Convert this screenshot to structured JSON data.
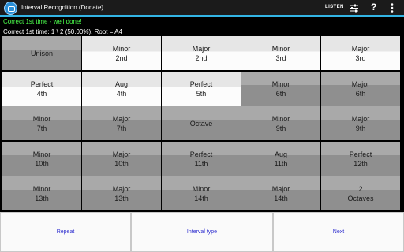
{
  "app": {
    "title": "Interval Recognition (Donate)",
    "listen_label": "LISTEN",
    "help_label": "?"
  },
  "status": {
    "message": "Correct 1st time - well done!",
    "score": "Correct 1st time: 1 \\ 2 (50.00%).  Root = A4",
    "message_color": "#4cff4c"
  },
  "intervals": [
    {
      "line1": "Unison",
      "line2": "",
      "state": "gray"
    },
    {
      "line1": "Minor",
      "line2": "2nd",
      "state": "light"
    },
    {
      "line1": "Major",
      "line2": "2nd",
      "state": "light"
    },
    {
      "line1": "Minor",
      "line2": "3rd",
      "state": "light"
    },
    {
      "line1": "Major",
      "line2": "3rd",
      "state": "light"
    },
    {
      "line1": "Perfect",
      "line2": "4th",
      "state": "light"
    },
    {
      "line1": "Aug",
      "line2": "4th",
      "state": "light"
    },
    {
      "line1": "Perfect",
      "line2": "5th",
      "state": "light"
    },
    {
      "line1": "Minor",
      "line2": "6th",
      "state": "gray"
    },
    {
      "line1": "Major",
      "line2": "6th",
      "state": "gray"
    },
    {
      "line1": "Minor",
      "line2": "7th",
      "state": "gray"
    },
    {
      "line1": "Major",
      "line2": "7th",
      "state": "gray"
    },
    {
      "line1": "Octave",
      "line2": "",
      "state": "gray"
    },
    {
      "line1": "Minor",
      "line2": "9th",
      "state": "gray"
    },
    {
      "line1": "Major",
      "line2": "9th",
      "state": "gray"
    },
    {
      "line1": "Minor",
      "line2": "10th",
      "state": "gray"
    },
    {
      "line1": "Major",
      "line2": "10th",
      "state": "gray"
    },
    {
      "line1": "Perfect",
      "line2": "11th",
      "state": "gray"
    },
    {
      "line1": "Aug",
      "line2": "11th",
      "state": "gray"
    },
    {
      "line1": "Perfect",
      "line2": "12th",
      "state": "gray"
    },
    {
      "line1": "Minor",
      "line2": "13th",
      "state": "gray"
    },
    {
      "line1": "Major",
      "line2": "13th",
      "state": "gray"
    },
    {
      "line1": "Minor",
      "line2": "14th",
      "state": "gray"
    },
    {
      "line1": "Major",
      "line2": "14th",
      "state": "gray"
    },
    {
      "line1": "2",
      "line2": "Octaves",
      "state": "gray"
    }
  ],
  "bottom_buttons": {
    "repeat": "Repeat",
    "interval_type": "Interval type",
    "next": "Next"
  },
  "colors": {
    "accent": "#33b5e5",
    "link_text": "#3030d0"
  }
}
